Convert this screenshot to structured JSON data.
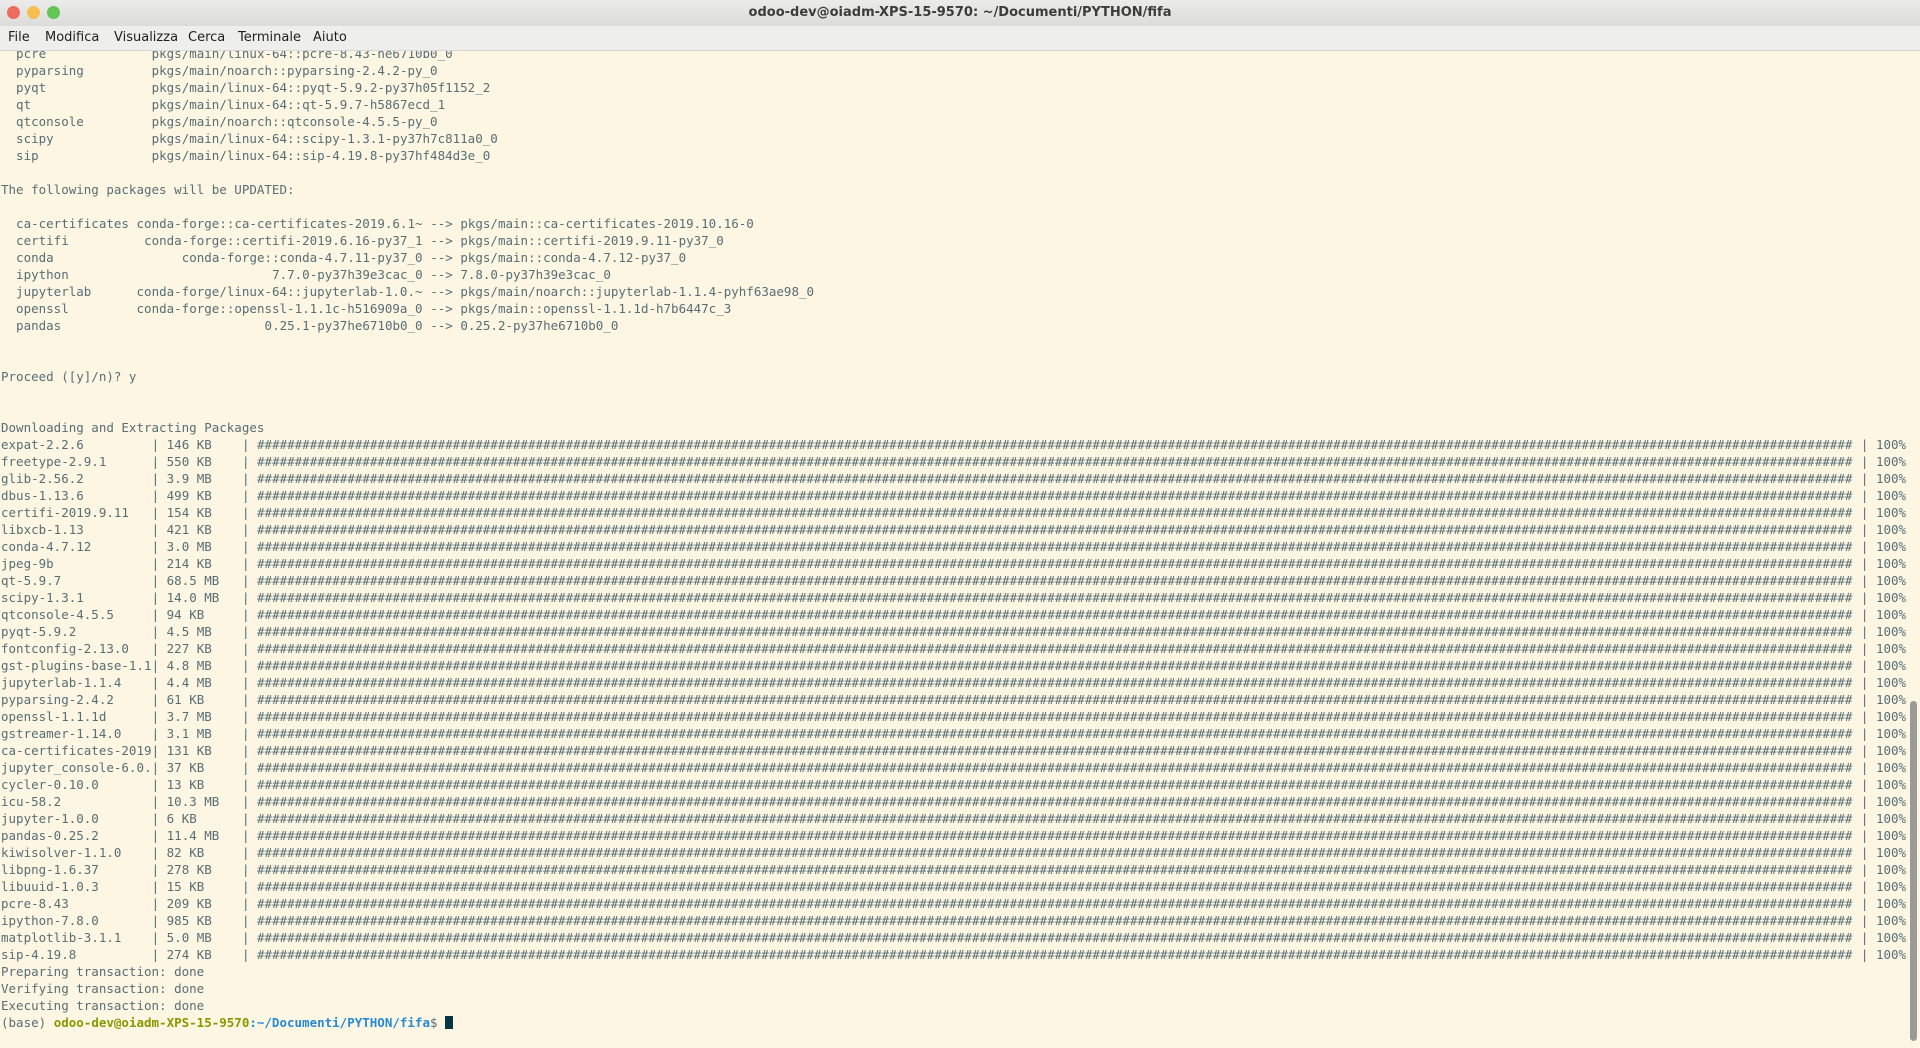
{
  "window": {
    "title": "odoo-dev@oiadm-XPS-15-9570: ~/Documenti/PYTHON/fifa",
    "controls": {
      "close_color": "#ed6b5f",
      "minimize_color": "#f5bf4f",
      "maximize_color": "#62c655"
    }
  },
  "menu": [
    "File",
    "Modifica",
    "Visualizza",
    "Cerca",
    "Terminale",
    "Aiuto"
  ],
  "theme": {
    "background": "#fdf6e3",
    "text": "#586e75",
    "user": "#859900",
    "path": "#268bd2"
  },
  "new_packages": [
    {
      "name": "pcre",
      "spec": "pkgs/main/linux-64::pcre-8.43-he6710b0_0"
    },
    {
      "name": "pyparsing",
      "spec": "pkgs/main/noarch::pyparsing-2.4.2-py_0"
    },
    {
      "name": "pyqt",
      "spec": "pkgs/main/linux-64::pyqt-5.9.2-py37h05f1152_2"
    },
    {
      "name": "qt",
      "spec": "pkgs/main/linux-64::qt-5.9.7-h5867ecd_1"
    },
    {
      "name": "qtconsole",
      "spec": "pkgs/main/noarch::qtconsole-4.5.5-py_0"
    },
    {
      "name": "scipy",
      "spec": "pkgs/main/linux-64::scipy-1.3.1-py37h7c811a0_0"
    },
    {
      "name": "sip",
      "spec": "pkgs/main/linux-64::sip-4.19.8-py37hf484d3e_0"
    }
  ],
  "updated_header": "The following packages will be UPDATED:",
  "updated_packages": [
    {
      "name": "ca-certificates",
      "from": "conda-forge::ca-certificates-2019.6.1~",
      "to": "pkgs/main::ca-certificates-2019.10.16-0"
    },
    {
      "name": "certifi",
      "from": "conda-forge::certifi-2019.6.16-py37_1",
      "to": "pkgs/main::certifi-2019.9.11-py37_0"
    },
    {
      "name": "conda",
      "from": "conda-forge::conda-4.7.11-py37_0",
      "to": "pkgs/main::conda-4.7.12-py37_0"
    },
    {
      "name": "ipython",
      "from": "7.7.0-py37h39e3cac_0",
      "to": "7.8.0-py37h39e3cac_0"
    },
    {
      "name": "jupyterlab",
      "from": "conda-forge/linux-64::jupyterlab-1.0.~",
      "to": "pkgs/main/noarch::jupyterlab-1.1.4-pyhf63ae98_0"
    },
    {
      "name": "openssl",
      "from": "conda-forge::openssl-1.1.1c-h516909a_0",
      "to": "pkgs/main::openssl-1.1.1d-h7b6447c_3"
    },
    {
      "name": "pandas",
      "from": "0.25.1-py37he6710b0_0",
      "to": "0.25.2-py37he6710b0_0"
    }
  ],
  "arrow": "-->",
  "proceed_prompt": "Proceed ([y]/n)? y",
  "download_header": "Downloading and Extracting Packages",
  "downloads": [
    {
      "name": "expat-2.2.6",
      "size": "146 KB",
      "progress": "100%"
    },
    {
      "name": "freetype-2.9.1",
      "size": "550 KB",
      "progress": "100%"
    },
    {
      "name": "glib-2.56.2",
      "size": "3.9 MB",
      "progress": "100%"
    },
    {
      "name": "dbus-1.13.6",
      "size": "499 KB",
      "progress": "100%"
    },
    {
      "name": "certifi-2019.9.11",
      "size": "154 KB",
      "progress": "100%"
    },
    {
      "name": "libxcb-1.13",
      "size": "421 KB",
      "progress": "100%"
    },
    {
      "name": "conda-4.7.12",
      "size": "3.0 MB",
      "progress": "100%"
    },
    {
      "name": "jpeg-9b",
      "size": "214 KB",
      "progress": "100%"
    },
    {
      "name": "qt-5.9.7",
      "size": "68.5 MB",
      "progress": "100%"
    },
    {
      "name": "scipy-1.3.1",
      "size": "14.0 MB",
      "progress": "100%"
    },
    {
      "name": "qtconsole-4.5.5",
      "size": "94 KB",
      "progress": "100%"
    },
    {
      "name": "pyqt-5.9.2",
      "size": "4.5 MB",
      "progress": "100%"
    },
    {
      "name": "fontconfig-2.13.0",
      "size": "227 KB",
      "progress": "100%"
    },
    {
      "name": "gst-plugins-base-1.1",
      "size": "4.8 MB",
      "progress": "100%"
    },
    {
      "name": "jupyterlab-1.1.4",
      "size": "4.4 MB",
      "progress": "100%"
    },
    {
      "name": "pyparsing-2.4.2",
      "size": "61 KB",
      "progress": "100%"
    },
    {
      "name": "openssl-1.1.1d",
      "size": "3.7 MB",
      "progress": "100%"
    },
    {
      "name": "gstreamer-1.14.0",
      "size": "3.1 MB",
      "progress": "100%"
    },
    {
      "name": "ca-certificates-2019",
      "size": "131 KB",
      "progress": "100%"
    },
    {
      "name": "jupyter_console-6.0.",
      "size": "37 KB",
      "progress": "100%"
    },
    {
      "name": "cycler-0.10.0",
      "size": "13 KB",
      "progress": "100%"
    },
    {
      "name": "icu-58.2",
      "size": "10.3 MB",
      "progress": "100%"
    },
    {
      "name": "jupyter-1.0.0",
      "size": "6 KB",
      "progress": "100%"
    },
    {
      "name": "pandas-0.25.2",
      "size": "11.4 MB",
      "progress": "100%"
    },
    {
      "name": "kiwisolver-1.1.0",
      "size": "82 KB",
      "progress": "100%"
    },
    {
      "name": "libpng-1.6.37",
      "size": "278 KB",
      "progress": "100%"
    },
    {
      "name": "libuuid-1.0.3",
      "size": "15 KB",
      "progress": "100%"
    },
    {
      "name": "pcre-8.43",
      "size": "209 KB",
      "progress": "100%"
    },
    {
      "name": "ipython-7.8.0",
      "size": "985 KB",
      "progress": "100%"
    },
    {
      "name": "matplotlib-3.1.1",
      "size": "5.0 MB",
      "progress": "100%"
    },
    {
      "name": "sip-4.19.8",
      "size": "274 KB",
      "progress": "100%"
    }
  ],
  "progress_bar": "####################################################################################################################################################################################################################",
  "transactions": [
    "Preparing transaction: done",
    "Verifying transaction: done",
    "Executing transaction: done"
  ],
  "prompt": {
    "env": "(base)",
    "user_host": "odoo-dev@oiadm-XPS-15-9570",
    "path": ":~/Documenti/PYTHON/fifa",
    "symbol": "$"
  }
}
